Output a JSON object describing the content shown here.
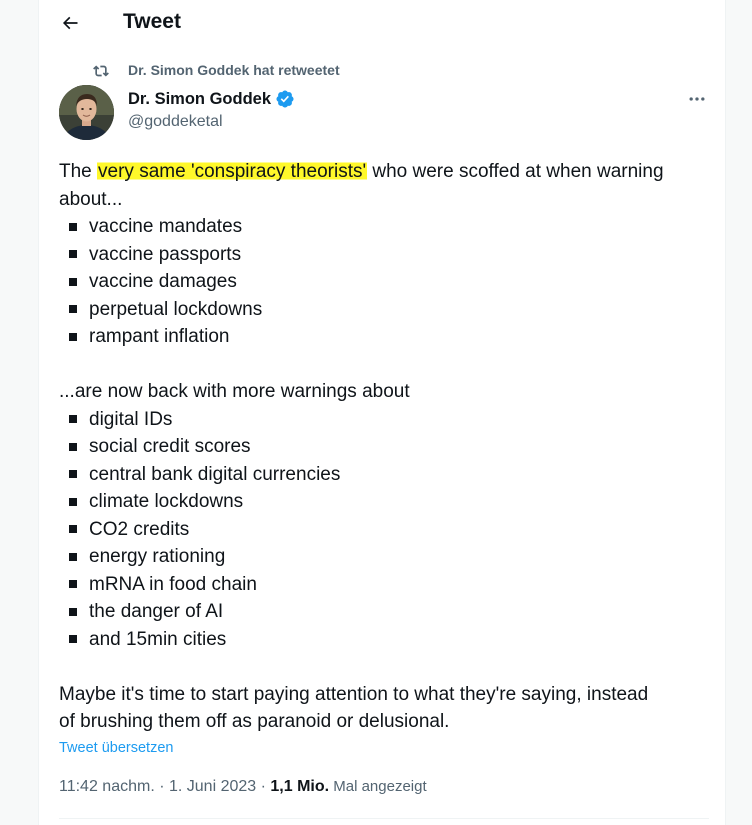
{
  "header": {
    "title": "Tweet"
  },
  "retweet": {
    "text": "Dr. Simon Goddek hat retweetet"
  },
  "author": {
    "name": "Dr. Simon Goddek",
    "handle": "@goddeketal",
    "verified": true
  },
  "tweet": {
    "intro_part1": "The ",
    "intro_highlight": "very same 'conspiracy theorists'",
    "intro_part2": " who were scoffed at when warning",
    "intro_line2": "about...",
    "list1": [
      "vaccine mandates",
      "vaccine passports",
      "vaccine damages",
      "perpetual lockdowns",
      "rampant inflation"
    ],
    "middle": "...are now back with more warnings about",
    "list2": [
      "digital IDs",
      "social credit scores",
      "central bank digital currencies",
      "climate lockdowns",
      "CO2 credits",
      "energy rationing",
      "mRNA in food chain",
      "the danger of AI",
      "and 15min cities"
    ],
    "closing_line1": "Maybe it's time to start paying attention to what they're saying, instead",
    "closing_line2": "of brushing them off as paranoid or delusional."
  },
  "translate_label": "Tweet übersetzen",
  "meta": {
    "time_date": "11:42 nachm. · 1. Juni 2023 · ",
    "views_count": "1,1 Mio.",
    "views_label": " Mal angezeigt"
  },
  "colors": {
    "accent": "#1d9bf0",
    "highlight": "#fff82a",
    "secondary_text": "#536471"
  },
  "icons": {
    "back": "arrow-left-icon",
    "retweet": "retweet-icon",
    "verified": "verified-badge-icon",
    "more": "more-horizontal-icon"
  }
}
